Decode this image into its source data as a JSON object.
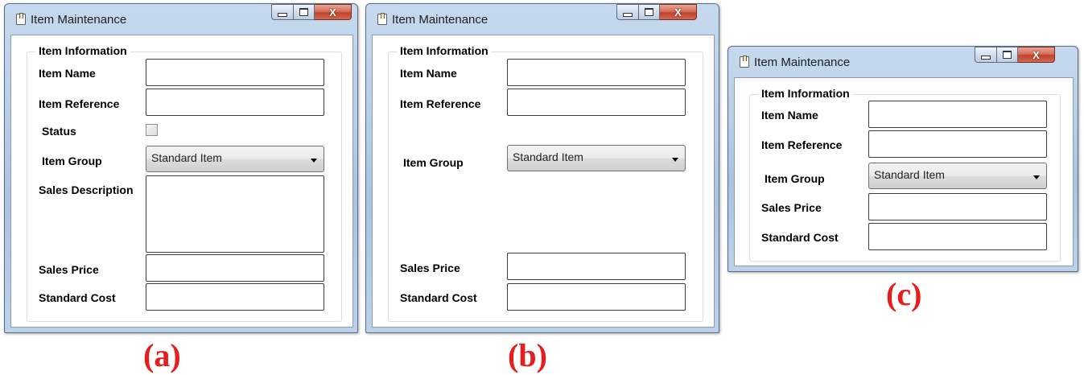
{
  "windows": [
    {
      "title": "Item Maintenance",
      "group_title": "Item Information",
      "labels": {
        "item_name": "Item Name",
        "item_reference": "Item Reference",
        "status": "Status",
        "item_group": "Item Group",
        "sales_description": "Sales Description",
        "sales_price": "Sales Price",
        "standard_cost": "Standard Cost"
      },
      "item_group_value": "Standard Item",
      "status_checked": false,
      "caption": "(a)"
    },
    {
      "title": "Item Maintenance",
      "group_title": "Item Information",
      "labels": {
        "item_name": "Item Name",
        "item_reference": "Item Reference",
        "item_group": "Item Group",
        "sales_price": "Sales Price",
        "standard_cost": "Standard Cost"
      },
      "item_group_value": "Standard Item",
      "caption": "(b)"
    },
    {
      "title": "Item Maintenance",
      "group_title": "Item Information",
      "labels": {
        "item_name": "Item Name",
        "item_reference": "Item Reference",
        "item_group": "Item Group",
        "sales_price": "Sales Price",
        "standard_cost": "Standard Cost"
      },
      "item_group_value": "Standard Item",
      "caption": "(c)"
    }
  ],
  "window_buttons": {
    "close_glyph": "X"
  },
  "icons": {
    "window_icon": "document-icon",
    "dropdown": "chevron-down-icon"
  },
  "colors": {
    "caption": "#e41e1e",
    "titlebar": "#b9d1ea"
  }
}
